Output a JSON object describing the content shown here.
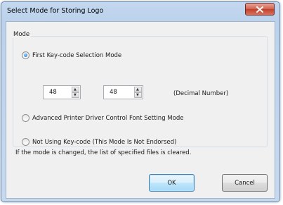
{
  "dialog": {
    "title": "Select Mode for Storing Logo",
    "group_label": "Mode",
    "options": [
      {
        "label": "First Key-code Selection Mode",
        "checked": true
      },
      {
        "label": "Advanced Printer Driver Control Font Setting Mode",
        "checked": false
      },
      {
        "label": "Not Using Key-code (This Mode Is Not Endorsed)",
        "checked": false
      }
    ],
    "key_code_1": "48",
    "key_code_2": "48",
    "decimal_label": "(Decimal Number)",
    "note": "If the mode is changed, the list of specified files is cleared.",
    "ok_label": "OK",
    "cancel_label": "Cancel"
  },
  "icons": {
    "close": "close-icon",
    "spin_up": "up-arrow-icon",
    "spin_down": "down-arrow-icon"
  },
  "colors": {
    "titlebar": "#bcd2ec",
    "close_button": "#c0402c",
    "selected_radio": "#1e6fbf",
    "default_button": "#bee6fd"
  }
}
